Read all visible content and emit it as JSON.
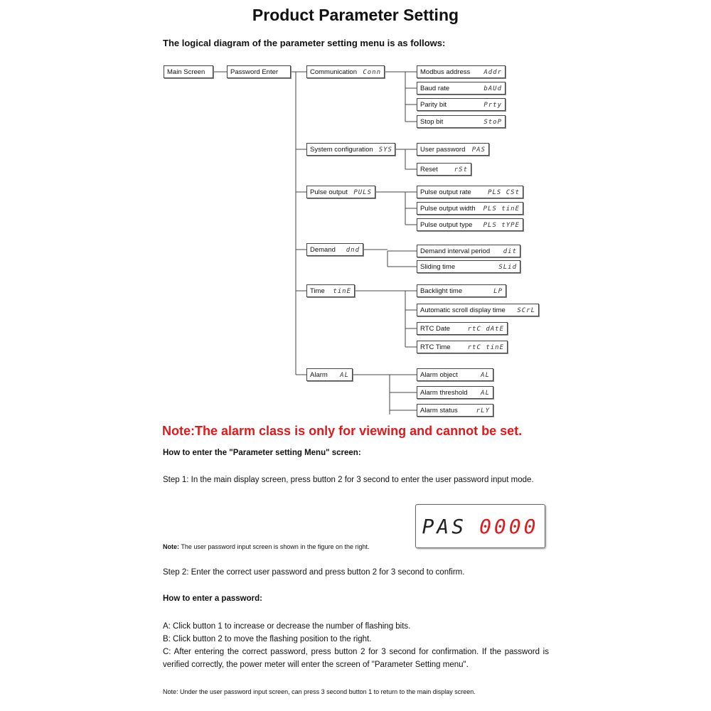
{
  "title": "Product Parameter Setting",
  "intro": "The logical diagram of the parameter setting menu is as follows:",
  "diagram": {
    "main_screen": "Main Screen",
    "password_enter": "Password Enter",
    "groups": [
      {
        "label": "Communication",
        "code": "Conn",
        "items": [
          {
            "label": "Modbus address",
            "code": "Addr"
          },
          {
            "label": "Baud rate",
            "code": "bAUd"
          },
          {
            "label": "Parity bit",
            "code": "Prty"
          },
          {
            "label": "Stop bit",
            "code": "StoP"
          }
        ]
      },
      {
        "label": "System configuration",
        "code": "SYS",
        "items": [
          {
            "label": "User password",
            "code": "PAS"
          },
          {
            "label": "Reset",
            "code": "rSt"
          }
        ]
      },
      {
        "label": "Pulse output",
        "code": "PULS",
        "items": [
          {
            "label": "Pulse output rate",
            "code": "PLS CSt"
          },
          {
            "label": "Pulse output width",
            "code": "PLS tinE"
          },
          {
            "label": "Pulse output type",
            "code": "PLS tYPE"
          }
        ]
      },
      {
        "label": "Demand",
        "code": "dnd",
        "items": [
          {
            "label": "Demand interval period",
            "code": "dit"
          },
          {
            "label": "Sliding time",
            "code": "SLid"
          }
        ]
      },
      {
        "label": "Time",
        "code": "tinE",
        "items": [
          {
            "label": "Backlight time",
            "code": "LP"
          },
          {
            "label": "Automatic scroll display time",
            "code": "SCrL"
          },
          {
            "label": "RTC Date",
            "code": "rtC dAtE"
          },
          {
            "label": "RTC Time",
            "code": "rtC tinE"
          }
        ]
      },
      {
        "label": "Alarm",
        "code": "AL",
        "items": [
          {
            "label": "Alarm object",
            "code": "AL"
          },
          {
            "label": "Alarm threshold",
            "code": "AL"
          },
          {
            "label": "Alarm status",
            "code": "rLY"
          }
        ]
      }
    ]
  },
  "note_red": "Note:The alarm class is only for viewing and cannot be set.",
  "enter_menu_heading": "How to enter the \"Parameter setting Menu\" screen:",
  "step1": "Step 1: In the main display screen, press button 2 for 3 second to enter the user password input mode.",
  "lcd": {
    "left": "PAS",
    "right": "0000",
    "right_color": "#e0191c"
  },
  "note1_label": "Note:",
  "note1_text": " The user password input screen is shown in the figure on the right.",
  "step2": "Step 2: Enter the correct user password and press button 2 for 3 second to confirm.",
  "password_heading": "How to enter a password:",
  "pw_a": "A: Click button 1 to increase or decrease the number of flashing bits.",
  "pw_b": "B: Click button 2 to move the flashing position to the right.",
  "pw_c": "C: After entering the correct password, press button 2 for 3 second for confirmation. If the password is verified correctly, the power meter will enter the screen of \"Parameter Setting menu\".",
  "note2": "Note: Under the user password input screen, can press 3 second button 1 to return to the main display screen."
}
